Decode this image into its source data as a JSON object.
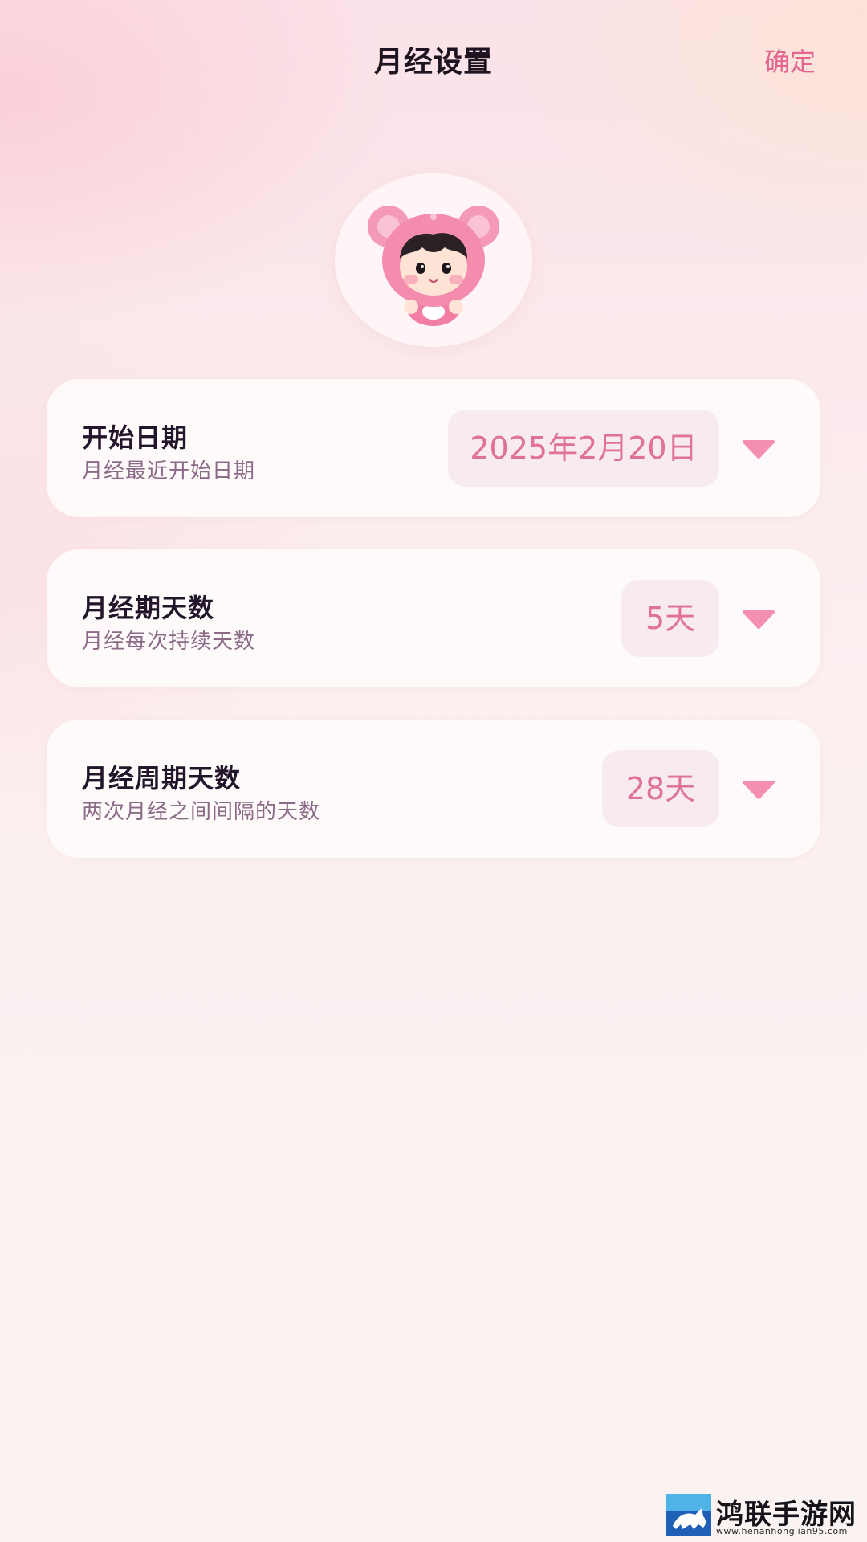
{
  "header": {
    "title": "月经设置",
    "confirm_label": "确定"
  },
  "avatar": {
    "icon": "pink-bear-hood-mascot"
  },
  "settings": [
    {
      "title": "开始日期",
      "subtitle": "月经最近开始日期",
      "value": "2025年2月20日"
    },
    {
      "title": "月经期天数",
      "subtitle": "月经每次持续天数",
      "value": "5天"
    },
    {
      "title": "月经周期天数",
      "subtitle": "两次月经之间间隔的天数",
      "value": "28天"
    }
  ],
  "colors": {
    "accent": "#e2668f",
    "value_text": "#e07199",
    "value_bg": "#f7ebef",
    "dropdown": "#f48fb1"
  },
  "watermark": {
    "name": "鸿联手游网",
    "url": "www.henanhonglian95.com"
  }
}
